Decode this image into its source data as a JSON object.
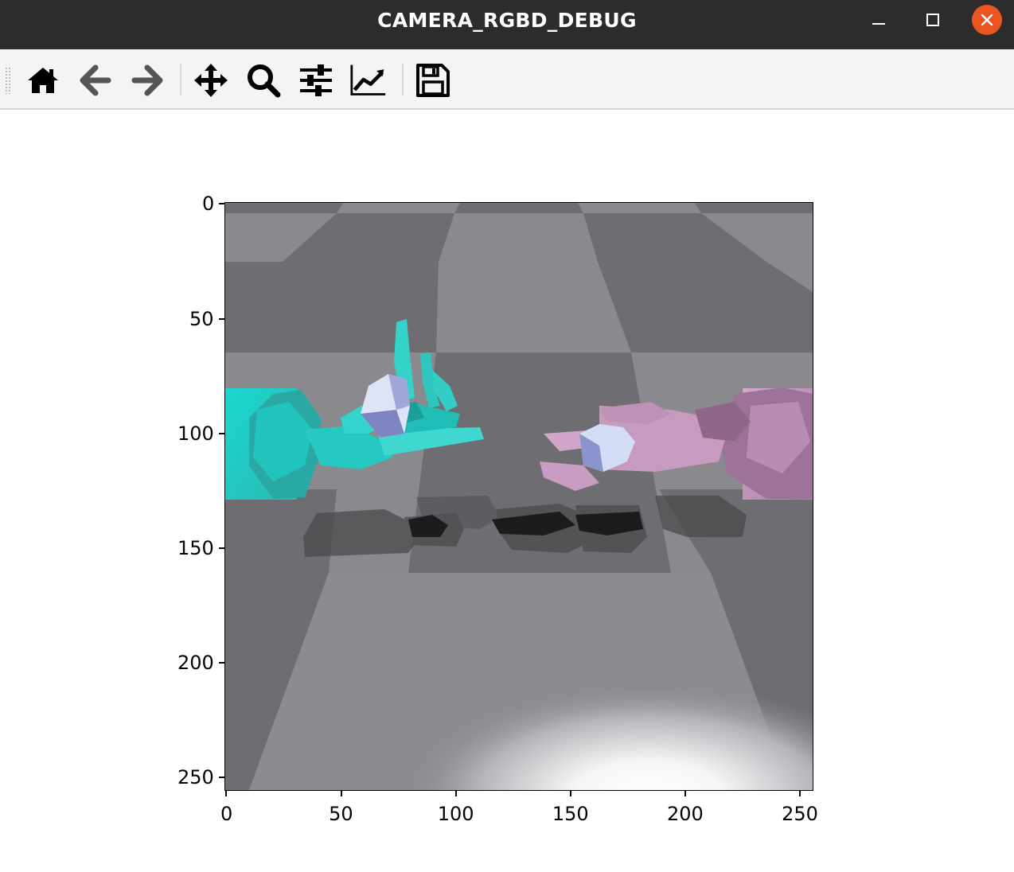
{
  "window": {
    "title": "CAMERA_RGBD_DEBUG"
  },
  "toolbar": {
    "tools": [
      {
        "name": "home",
        "icon": "home-icon"
      },
      {
        "name": "back",
        "icon": "arrow-left-icon"
      },
      {
        "name": "forward",
        "icon": "arrow-right-icon"
      },
      {
        "name": "pan",
        "icon": "move-icon"
      },
      {
        "name": "zoom",
        "icon": "magnifier-icon"
      },
      {
        "name": "configure-subplots",
        "icon": "sliders-icon"
      },
      {
        "name": "edit-axes",
        "icon": "line-chart-icon"
      },
      {
        "name": "save",
        "icon": "floppy-disk-icon"
      }
    ]
  },
  "plot": {
    "x_ticks": [
      "0",
      "50",
      "100",
      "150",
      "200",
      "250"
    ],
    "y_ticks": [
      "0",
      "50",
      "100",
      "150",
      "200",
      "250"
    ],
    "x_tick_values": [
      0,
      50,
      100,
      150,
      200,
      250
    ],
    "y_tick_values": [
      0,
      50,
      100,
      150,
      200,
      250
    ],
    "xlim": [
      -0.5,
      255.5
    ],
    "ylim": [
      255.5,
      -0.5
    ],
    "image_size": [
      256,
      256
    ],
    "colors": {
      "floor_light": "#8a8a8e",
      "floor_dark": "#6e6e72",
      "left_hand": "#3fcfc8",
      "right_hand": "#c99ac2",
      "object": "#b9c4ee",
      "shadow": "#3c3c3e",
      "close_button": "#e95420"
    }
  }
}
